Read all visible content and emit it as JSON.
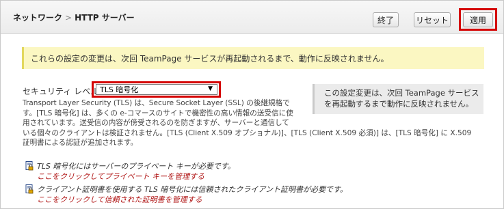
{
  "breadcrumb": {
    "parent": "ネットワーク",
    "separator": ">",
    "current": "HTTP サーバー"
  },
  "toolbar": {
    "end_label": "終了",
    "reset_label": "リセット",
    "apply_label": "適用"
  },
  "notice": {
    "text": "これらの設定の変更は、次回 TeamPage サービスが再起動されるまで、動作に反映されません。"
  },
  "security": {
    "label": "セキュリティ レベル",
    "selected": "TLS 暗号化",
    "description_lines": [
      "Transport Layer Security (TLS) は、Secure Socket Layer (SSL) の後継規格で",
      "す。[TLS 暗号化] は、多くの e-コマースのサイトで機密性の高い情報の送受信に使",
      "用されています。送受信の内容が傍受されるのを防ぎますが、サーバーと通信して",
      "いる個々のクライアントは検証されません。[TLS (Client X.509 オプショナル)]、[TLS (Client X.509 必須)] は、[TLS 暗号化] に X.509",
      "証明書による認証が追加されます。"
    ]
  },
  "sidebox": {
    "line1": "この設定変更は、次回 TeamPage サービス",
    "line2": "を再起動するまで動作に反映されません。"
  },
  "warnings": [
    {
      "icon": "certificate-lock-icon",
      "text": "TLS 暗号化にはサーバーのプライベート キーが必要です。",
      "link": "ここをクリックしてプライベート キーを管理する"
    },
    {
      "icon": "certificate-lock-icon",
      "text": "クライアント証明書を使用する TLS 暗号化には信頼されたクライアント証明書が必要です。",
      "link": "ここをクリックして信頼された証明書を管理する"
    }
  ],
  "colors": {
    "highlight": "#d40000",
    "notice_bg": "#fbf7c2",
    "link": "#b01414"
  }
}
